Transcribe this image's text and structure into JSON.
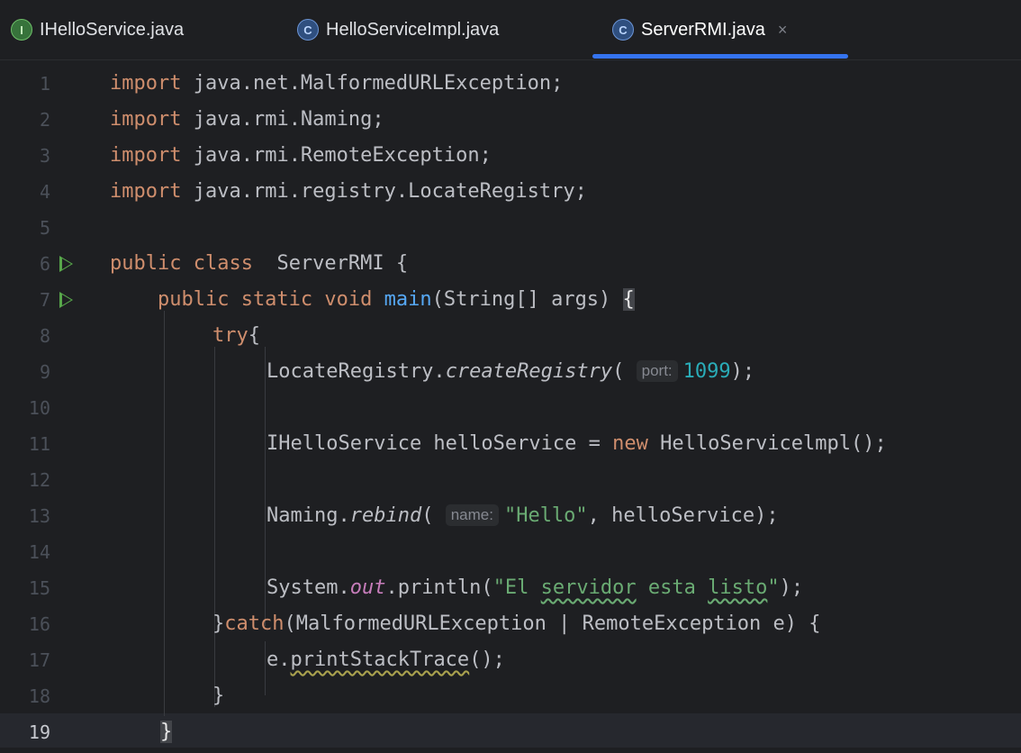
{
  "tabs": [
    {
      "label": "IHelloService.java",
      "icon": "interface-icon",
      "icon_letter": "I",
      "active": false
    },
    {
      "label": "HelloServiceImpl.java",
      "icon": "class-icon",
      "icon_letter": "C",
      "active": false
    },
    {
      "label": "ServerRMI.java",
      "icon": "runnable-class-icon",
      "icon_letter": "C",
      "active": true,
      "close": "×"
    }
  ],
  "gutter": {
    "line_numbers": [
      "1",
      "2",
      "3",
      "4",
      "5",
      "6",
      "7",
      "8",
      "9",
      "10",
      "11",
      "12",
      "13",
      "14",
      "15",
      "16",
      "17",
      "18",
      "19"
    ],
    "current_line": "19"
  },
  "code": {
    "l1_kw": "import",
    "l1_rest": " java.net.MalformedURLException;",
    "l2_kw": "import",
    "l2_rest": " java.rmi.Naming;",
    "l3_kw": "import",
    "l3_rest": " java.rmi.RemoteException;",
    "l4_kw": "import",
    "l4_rest": " java.rmi.registry.LocateRegistry;",
    "l6_kw": "public class",
    "l6_rest": "  ServerRMI {",
    "l7_kw": "    public static void ",
    "l7_fn": "main",
    "l7_rest": "(String[] args) ",
    "l7_brace": "{",
    "l8_kw": "try",
    "l8_rest": "{",
    "l9_a": "LocateRegistry.",
    "l9_method": "createRegistry",
    "l9_b": "( ",
    "l9_hint": "port:",
    "l9_num": "1099",
    "l9_c": ");",
    "l11_a": "IHelloService helloService = ",
    "l11_kw": "new",
    "l11_b": " HelloServicelmpl();",
    "l13_a": "Naming.",
    "l13_method": "rebind",
    "l13_b": "( ",
    "l13_hint": "name:",
    "l13_str": "\"Hello\"",
    "l13_c": ", helloService);",
    "l15_a": "System.",
    "l15_static": "out",
    "l15_b": ".println(",
    "l15_s1": "\"El ",
    "l15_s2": "servidor",
    "l15_s3": " esta ",
    "l15_s4": "listo",
    "l15_s5": "\"",
    "l15_c": ");",
    "l16_a": "}",
    "l16_kw": "catch",
    "l16_b": "(MalformedURLException | RemoteException e) {",
    "l17_a": "e.",
    "l17_method": "printStackTrace",
    "l17_b": "();",
    "l18": "}",
    "l19": "}"
  },
  "colors": {
    "background": "#1e1f22",
    "keyword": "#cf8e6d",
    "string": "#6aab73",
    "number": "#2aacb8",
    "function": "#56a8f5",
    "accent": "#3574f0",
    "run_icon": "#57a64a"
  }
}
